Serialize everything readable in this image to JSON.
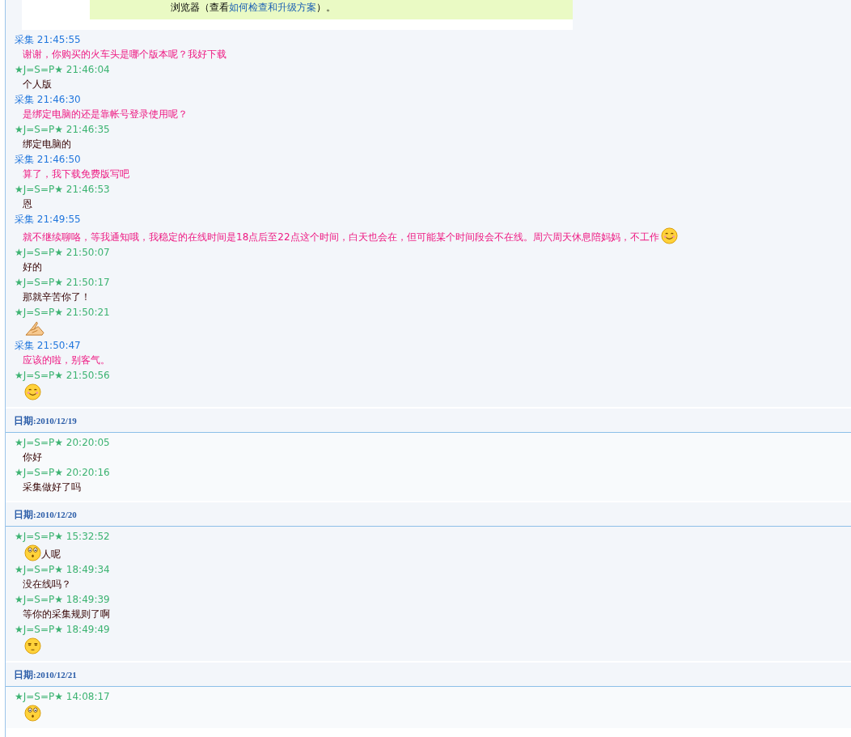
{
  "notice": {
    "text": "浏览器（查看",
    "link": "如何检查和升级方案",
    "suffix": "）。"
  },
  "days": [
    {
      "messages": [
        {
          "kind": "other",
          "name": "采集",
          "time": "21:45:55",
          "parts": [
            {
              "kind": "text",
              "text": "谢谢，你购买的火车头是哪个版本呢？我好下载"
            }
          ]
        },
        {
          "kind": "self",
          "name": "★J=S=P★",
          "time": "21:46:04",
          "parts": [
            {
              "kind": "text",
              "text": "个人版"
            }
          ]
        },
        {
          "kind": "other",
          "name": "采集",
          "time": "21:46:30",
          "parts": [
            {
              "kind": "text",
              "text": "是绑定电脑的还是靠帐号登录使用呢？"
            }
          ]
        },
        {
          "kind": "self",
          "name": "★J=S=P★",
          "time": "21:46:35",
          "parts": [
            {
              "kind": "text",
              "text": "绑定电脑的"
            }
          ]
        },
        {
          "kind": "other",
          "name": "采集",
          "time": "21:46:50",
          "parts": [
            {
              "kind": "text",
              "text": "算了，我下载免费版写吧"
            }
          ]
        },
        {
          "kind": "self",
          "name": "★J=S=P★",
          "time": "21:46:53",
          "parts": [
            {
              "kind": "text",
              "text": "恩"
            }
          ]
        },
        {
          "kind": "other",
          "name": "采集",
          "time": "21:49:55",
          "parts": [
            {
              "kind": "text",
              "text": "就不继续聊咯，等我通知哦，我稳定的在线时间是18点后至22点这个时间，白天也会在，但可能某个时间段会不在线。周六周天休息陪妈妈，不工作"
            },
            {
              "kind": "smile"
            }
          ]
        },
        {
          "kind": "self",
          "name": "★J=S=P★",
          "time": "21:50:07",
          "parts": [
            {
              "kind": "text",
              "text": "好的"
            }
          ]
        },
        {
          "kind": "self",
          "name": "★J=S=P★",
          "time": "21:50:17",
          "parts": [
            {
              "kind": "text",
              "text": "那就辛苦你了！"
            }
          ]
        },
        {
          "kind": "self",
          "name": "★J=S=P★",
          "time": "21:50:21",
          "parts": [
            {
              "kind": "hands"
            }
          ]
        },
        {
          "kind": "other",
          "name": "采集",
          "time": "21:50:47",
          "parts": [
            {
              "kind": "text",
              "text": "应该的啦，别客气。"
            }
          ]
        },
        {
          "kind": "self",
          "name": "★J=S=P★",
          "time": "21:50:56",
          "parts": [
            {
              "kind": "smile"
            }
          ]
        }
      ]
    },
    {
      "label": "日期",
      "date": ":2010/12/19",
      "messages": [
        {
          "kind": "self",
          "name": "★J=S=P★",
          "time": "20:20:05",
          "parts": [
            {
              "kind": "text",
              "text": "你好"
            }
          ]
        },
        {
          "kind": "self",
          "name": "★J=S=P★",
          "time": "20:20:16",
          "parts": [
            {
              "kind": "text",
              "text": "采集做好了吗"
            }
          ]
        }
      ]
    },
    {
      "label": "日期",
      "date": ":2010/12/20",
      "messages": [
        {
          "kind": "self",
          "name": "★J=S=P★",
          "time": "15:32:52",
          "parts": [
            {
              "kind": "surprised"
            },
            {
              "kind": "text",
              "text": "人呢"
            }
          ]
        },
        {
          "kind": "self",
          "name": "★J=S=P★",
          "time": "18:49:34",
          "parts": [
            {
              "kind": "text",
              "text": "没在线吗？"
            }
          ]
        },
        {
          "kind": "self",
          "name": "★J=S=P★",
          "time": "18:49:39",
          "parts": [
            {
              "kind": "text",
              "text": "等你的采集规则了啊"
            }
          ]
        },
        {
          "kind": "self",
          "name": "★J=S=P★",
          "time": "18:49:49",
          "parts": [
            {
              "kind": "smug"
            }
          ]
        }
      ]
    },
    {
      "label": "日期",
      "date": ":2010/12/21",
      "messages": [
        {
          "kind": "self",
          "name": "★J=S=P★",
          "time": "14:08:17",
          "parts": [
            {
              "kind": "surprised"
            }
          ]
        }
      ]
    }
  ]
}
